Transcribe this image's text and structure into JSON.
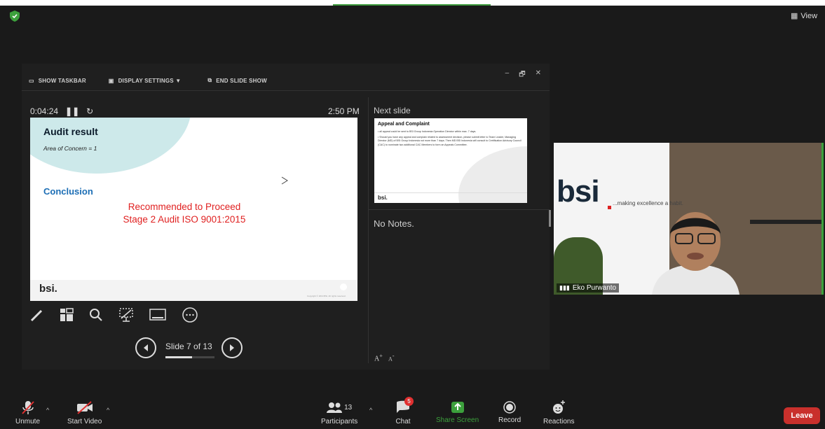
{
  "app": {
    "view_label": "View",
    "security_color": "#3ca03c"
  },
  "presenter": {
    "toolbar": {
      "show_taskbar": "SHOW TASKBAR",
      "display_settings": "DISPLAY SETTINGS ▼",
      "end_slide_show": "END SLIDE SHOW"
    },
    "window_controls": [
      "–",
      "🗗",
      "✕"
    ],
    "elapsed": "0:04:24",
    "clock": "2:50 PM",
    "next_slide_label": "Next slide",
    "notes": "No Notes.",
    "font_increase": "A",
    "font_decrease": "A",
    "slide_counter": "Slide 7 of 13",
    "progress": 0.538,
    "current_slide": {
      "title": "Audit result",
      "subtitle": "Area of Concern  =  1",
      "conclusion_heading": "Conclusion",
      "recommendation_line1": "Recommended to Proceed",
      "recommendation_line2": "Stage 2 Audit ISO 9001:2015",
      "logo": "bsi.",
      "copyright": "Copyright © 2019 BSI. All rights reserved."
    },
    "next_slide": {
      "title": "Appeal and Complaint",
      "bullet1": "• all appeal could be sent to BSI Group Indonesia Operation Director within max. 7 days.",
      "bullet2": "• Should you have any appeal and complain related to assessment decision, please submit letter to Team Leader, Managing Director (MD) of BSI Group Indonesia not more than 7 days. Then MD BSI Indonesia will consult to Certification Advisory Council (CAC) to nominate two additional CAC Members to form an Appeals Committee.",
      "logo": "bsi."
    }
  },
  "video": {
    "participant_name": "Eko Purwanto",
    "logo": "bsi",
    "tagline": "...making excellence a habit."
  },
  "bottom_bar": {
    "unmute": "Unmute",
    "start_video": "Start Video",
    "participants": "Participants",
    "participant_count": "13",
    "chat": "Chat",
    "chat_badge": "5",
    "share_screen": "Share Screen",
    "record": "Record",
    "reactions": "Reactions",
    "leave": "Leave",
    "share_color": "#3ca03c",
    "leave_color": "#c9302c"
  }
}
